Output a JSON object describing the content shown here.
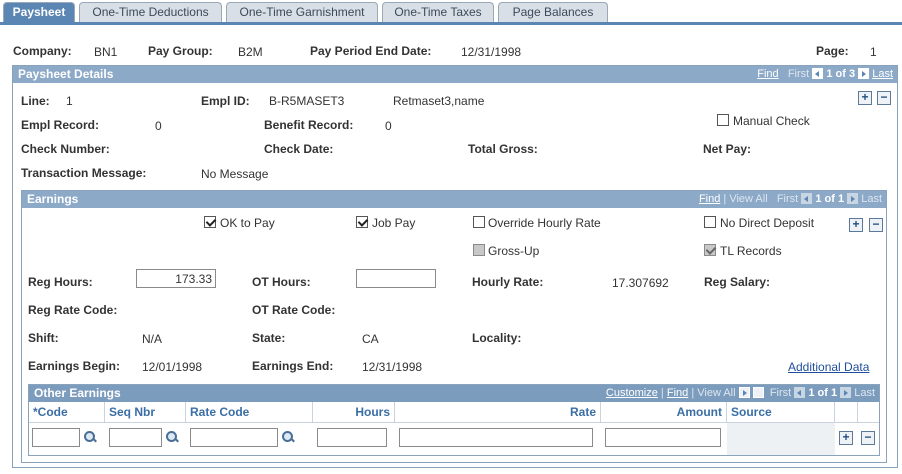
{
  "tabs": [
    {
      "label": "Paysheet"
    },
    {
      "label": "One-Time Deductions"
    },
    {
      "label": "One-Time Garnishment"
    },
    {
      "label": "One-Time Taxes"
    },
    {
      "label": "Page Balances"
    }
  ],
  "header": {
    "company_label": "Company:",
    "company": "BN1",
    "paygroup_label": "Pay Group:",
    "paygroup": "B2M",
    "period_label": "Pay Period End Date:",
    "period": "12/31/1998",
    "page_label": "Page:",
    "page": "1"
  },
  "details": {
    "title": "Paysheet Details",
    "nav": {
      "find": "Find",
      "first": "First",
      "count": "1 of 3",
      "last": "Last"
    },
    "line_label": "Line:",
    "line": "1",
    "emplid_label": "Empl ID:",
    "emplid": "B-R5MASET3",
    "name": "Retmaset3,name",
    "emplrec_label": "Empl Record:",
    "emplrec": "0",
    "benefit_label": "Benefit Record:",
    "benefit": "0",
    "manual_check": "Manual Check",
    "checknum_label": "Check Number:",
    "checkdate_label": "Check Date:",
    "totalgross_label": "Total Gross:",
    "netpay_label": "Net Pay:",
    "txmsg_label": "Transaction Message:",
    "txmsg": "No Message"
  },
  "earnings": {
    "title": "Earnings",
    "nav": {
      "find": "Find",
      "viewall": "View All",
      "first": "First",
      "count": "1 of 1",
      "last": "Last"
    },
    "ok_to_pay": "OK to Pay",
    "job_pay": "Job Pay",
    "override_rate": "Override Hourly Rate",
    "no_direct_deposit": "No Direct Deposit",
    "gross_up": "Gross-Up",
    "tl_records": "TL Records",
    "reg_hours_label": "Reg Hours:",
    "reg_hours": "173.33",
    "ot_hours_label": "OT Hours:",
    "ot_hours": "",
    "hourly_rate_label": "Hourly Rate:",
    "hourly_rate": "17.307692",
    "reg_salary_label": "Reg Salary:",
    "reg_rate_code_label": "Reg Rate Code:",
    "ot_rate_code_label": "OT Rate Code:",
    "shift_label": "Shift:",
    "shift": "N/A",
    "state_label": "State:",
    "state": "CA",
    "locality_label": "Locality:",
    "earn_begin_label": "Earnings Begin:",
    "earn_begin": "12/01/1998",
    "earn_end_label": "Earnings End:",
    "earn_end": "12/31/1998",
    "additional_data": "Additional Data"
  },
  "other_earnings": {
    "title": "Other Earnings",
    "nav": {
      "customize": "Customize",
      "find": "Find",
      "viewall": "View All",
      "first": "First",
      "count": "1 of 1",
      "last": "Last"
    },
    "columns": [
      "*Code",
      "Seq Nbr",
      "Rate Code",
      "Hours",
      "Rate",
      "Amount",
      "Source"
    ]
  },
  "colors": {
    "tab_active": "#5b86b3",
    "panel_header": "#8ca9c8",
    "link": "#1f4e9a"
  }
}
